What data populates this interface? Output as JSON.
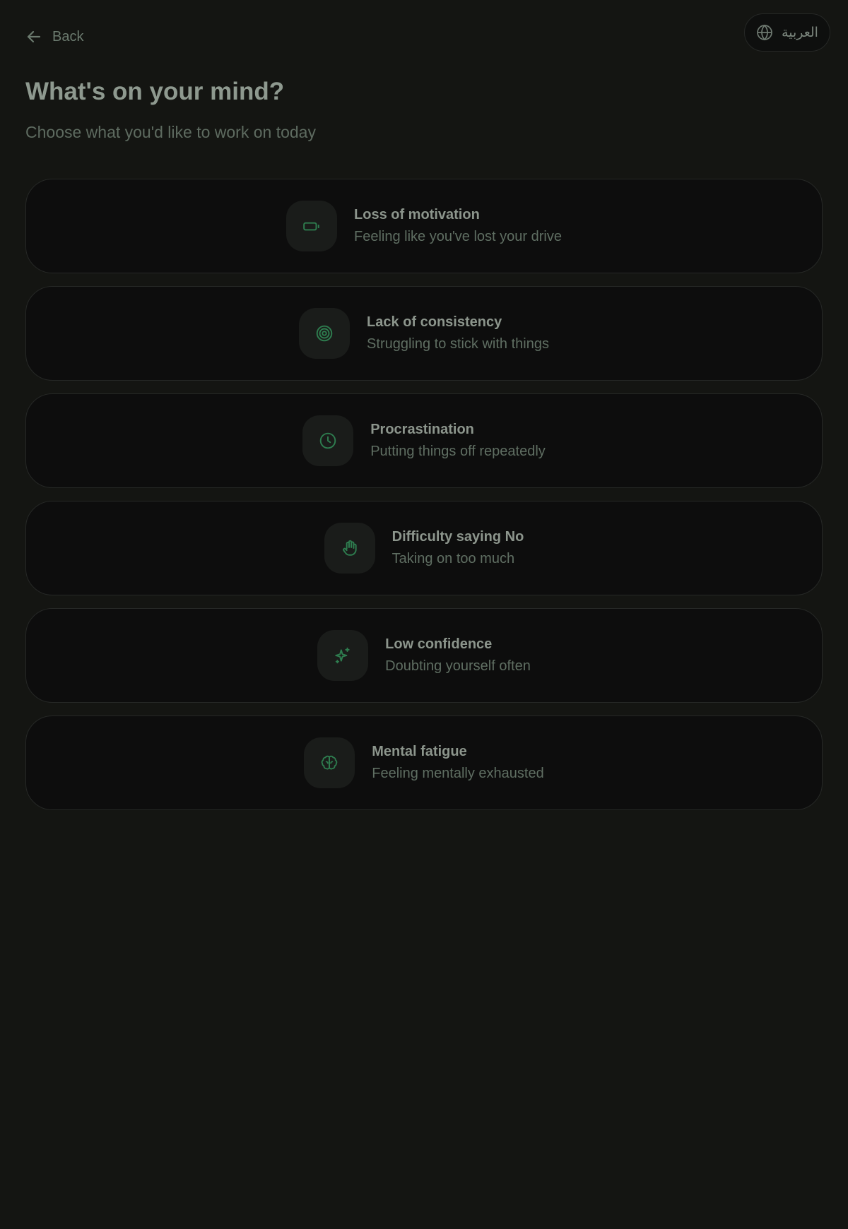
{
  "header": {
    "back_label": "Back",
    "language_label": "العربية"
  },
  "title": "What's on your mind?",
  "subtitle": "Choose what you'd like to work on today",
  "colors": {
    "background": "#141512",
    "card": "#0d0d0d",
    "accent": "#2e7d4f"
  },
  "options": [
    {
      "icon": "battery-low-icon",
      "title": "Loss of motivation",
      "description": "Feeling like you've lost your drive"
    },
    {
      "icon": "target-icon",
      "title": "Lack of consistency",
      "description": "Struggling to stick with things"
    },
    {
      "icon": "clock-icon",
      "title": "Procrastination",
      "description": "Putting things off repeatedly"
    },
    {
      "icon": "hand-stop-icon",
      "title": "Difficulty saying No",
      "description": "Taking on too much"
    },
    {
      "icon": "sparkles-icon",
      "title": "Low confidence",
      "description": "Doubting yourself often"
    },
    {
      "icon": "brain-icon",
      "title": "Mental fatigue",
      "description": "Feeling mentally exhausted"
    }
  ]
}
